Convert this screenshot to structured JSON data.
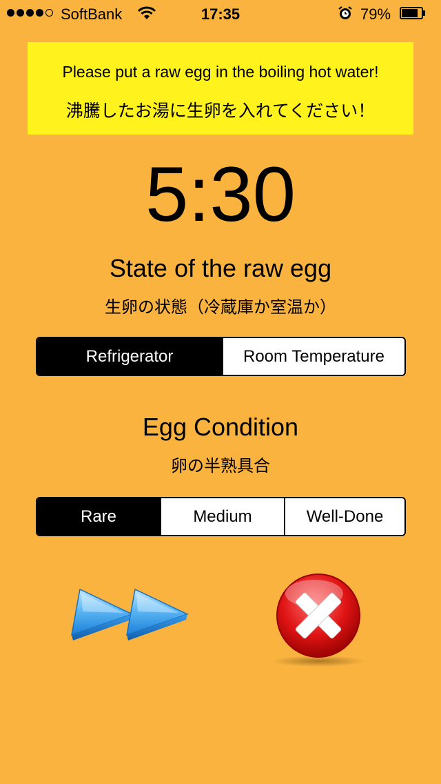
{
  "status_bar": {
    "carrier": "SoftBank",
    "time": "17:35",
    "battery_percent": "79%",
    "battery_level": 0.79,
    "signal_bars_filled": 4,
    "signal_bars_total": 5
  },
  "banner": {
    "text_en": "Please put a raw egg in the boiling hot water!",
    "text_jp": "沸騰したお湯に生卵を入れてください！"
  },
  "timer": {
    "value": "5:30"
  },
  "state_section": {
    "title": "State of the raw egg",
    "subtitle": "生卵の状態（冷蔵庫か室温か）",
    "options": [
      "Refrigerator",
      "Room Temperature"
    ],
    "selected_index": 0
  },
  "condition_section": {
    "title": "Egg Condition",
    "subtitle": "卵の半熟具合",
    "options": [
      "Rare",
      "Medium",
      "Well-Done"
    ],
    "selected_index": 0
  },
  "icons": {
    "start": "fast-forward-icon",
    "cancel": "cancel-x-icon"
  },
  "colors": {
    "background": "#FAB33F",
    "banner": "#FFF21D",
    "selected_segment": "#000000"
  }
}
